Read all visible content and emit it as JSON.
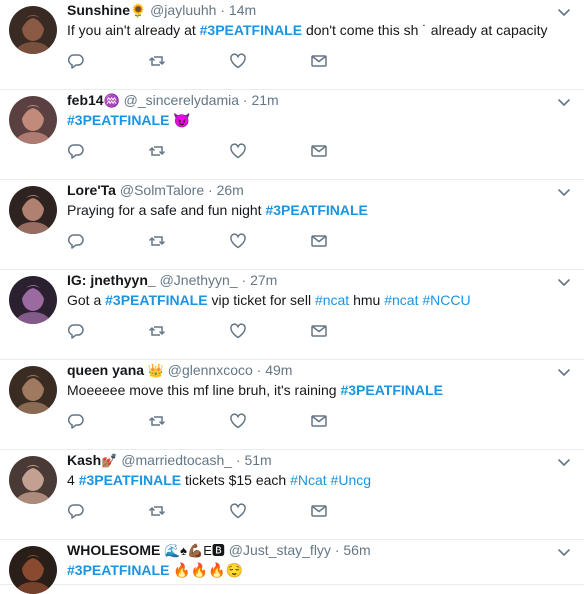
{
  "colors": {
    "link": "#1c94e0",
    "muted": "#657786",
    "border": "#e6ecf0"
  },
  "tweets": [
    {
      "name": "Sunshine",
      "name_emoji": "🌻",
      "handle": "@jayluuhh",
      "dot": "·",
      "time": "14m",
      "parts": [
        {
          "text": "If you ain't already at ",
          "type": "text"
        },
        {
          "text": "#3PEATFINALE",
          "type": "tag"
        },
        {
          "text": " don't come this sh ˙ already at capacity",
          "type": "text"
        }
      ]
    },
    {
      "name": "feb14",
      "name_emoji": "♒",
      "handle": "@_sincerelydamia",
      "dot": "·",
      "time": "21m",
      "parts": [
        {
          "text": "#3PEATFINALE",
          "type": "tag"
        },
        {
          "text": " 😈",
          "type": "text"
        }
      ]
    },
    {
      "name": "Lore'Ta",
      "name_emoji": "",
      "handle": "@SolmTalore",
      "dot": "·",
      "time": "26m",
      "parts": [
        {
          "text": "Praying for a safe and fun night ",
          "type": "text"
        },
        {
          "text": "#3PEATFINALE",
          "type": "tag"
        }
      ]
    },
    {
      "name": "IG: jnethyyn_",
      "name_emoji": "",
      "handle": "@Jnethyyn_",
      "dot": "·",
      "time": "27m",
      "parts": [
        {
          "text": "Got a  ",
          "type": "text"
        },
        {
          "text": "#3PEATFINALE",
          "type": "tag"
        },
        {
          "text": " vip ticket for sell  ",
          "type": "text"
        },
        {
          "text": "#ncat",
          "type": "tag-light"
        },
        {
          "text": "  hmu ",
          "type": "text"
        },
        {
          "text": "#ncat",
          "type": "tag-light"
        },
        {
          "text": " ",
          "type": "text"
        },
        {
          "text": "#NCCU",
          "type": "tag-light"
        }
      ]
    },
    {
      "name": "queen yana",
      "name_emoji": " 👑",
      "handle": "@glennxcoco",
      "dot": "·",
      "time": "49m",
      "parts": [
        {
          "text": "Moeeeee move this mf line bruh, it's raining ",
          "type": "text"
        },
        {
          "text": "#3PEATFINALE",
          "type": "tag"
        }
      ]
    },
    {
      "name": "Kash",
      "name_emoji": "💅🏽",
      "handle": "@marriedtocash_",
      "dot": "·",
      "time": "51m",
      "parts": [
        {
          "text": "4 ",
          "type": "text"
        },
        {
          "text": "#3PEATFINALE",
          "type": "tag"
        },
        {
          "text": " tickets $15 each ",
          "type": "text"
        },
        {
          "text": "#Ncat",
          "type": "tag-light"
        },
        {
          "text": " ",
          "type": "text"
        },
        {
          "text": "#Uncg",
          "type": "tag-light"
        }
      ]
    },
    {
      "name": "WHOLESOME",
      "name_emoji": " 🌊♠💪🏾E🅱",
      "handle": "@Just_stay_flyy",
      "dot": "·",
      "time": "56m",
      "parts": [
        {
          "text": "#3PEATFINALE",
          "type": "tag"
        },
        {
          "text": " 🔥🔥🔥😌",
          "type": "text"
        }
      ]
    }
  ]
}
